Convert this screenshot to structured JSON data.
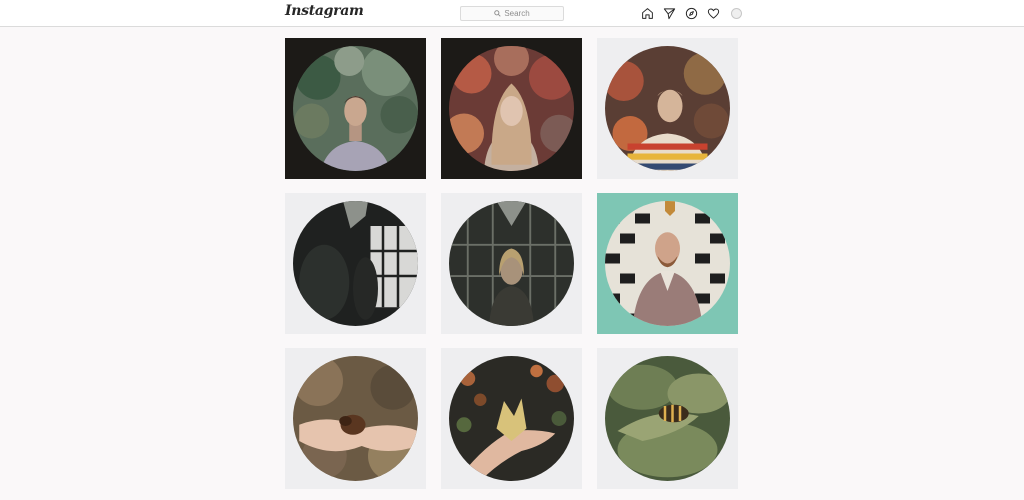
{
  "header": {
    "logo_text": "Instagram",
    "search_placeholder": "Search",
    "nav_icons": [
      "home-icon",
      "direct-icon",
      "explore-icon",
      "activity-heart-icon",
      "profile-avatar"
    ]
  },
  "grid": {
    "posts": [
      {
        "frame": "#1c1a17",
        "theme": "portrait-man-foliage"
      },
      {
        "frame": "#1c1a17",
        "theme": "portrait-woman-red-leaves"
      },
      {
        "frame": "#eeeef0",
        "theme": "portrait-man-striped-shirt"
      },
      {
        "frame": "#eeeef0",
        "theme": "greenhouse-dark"
      },
      {
        "frame": "#eeeef0",
        "theme": "greenhouse-woman"
      },
      {
        "frame": "#7ec6b4",
        "theme": "man-suit-tiles"
      },
      {
        "frame": "#eeeef0",
        "theme": "hands-chestnuts"
      },
      {
        "frame": "#eeeef0",
        "theme": "hand-yellow-leaf"
      },
      {
        "frame": "#eeeef0",
        "theme": "snail-on-leaf"
      }
    ]
  },
  "colors": {
    "page_bg": "#faf8f9",
    "header_bg": "#ffffff",
    "border": "#dbdbdb",
    "text": "#262626",
    "muted": "#8e8e8e"
  }
}
